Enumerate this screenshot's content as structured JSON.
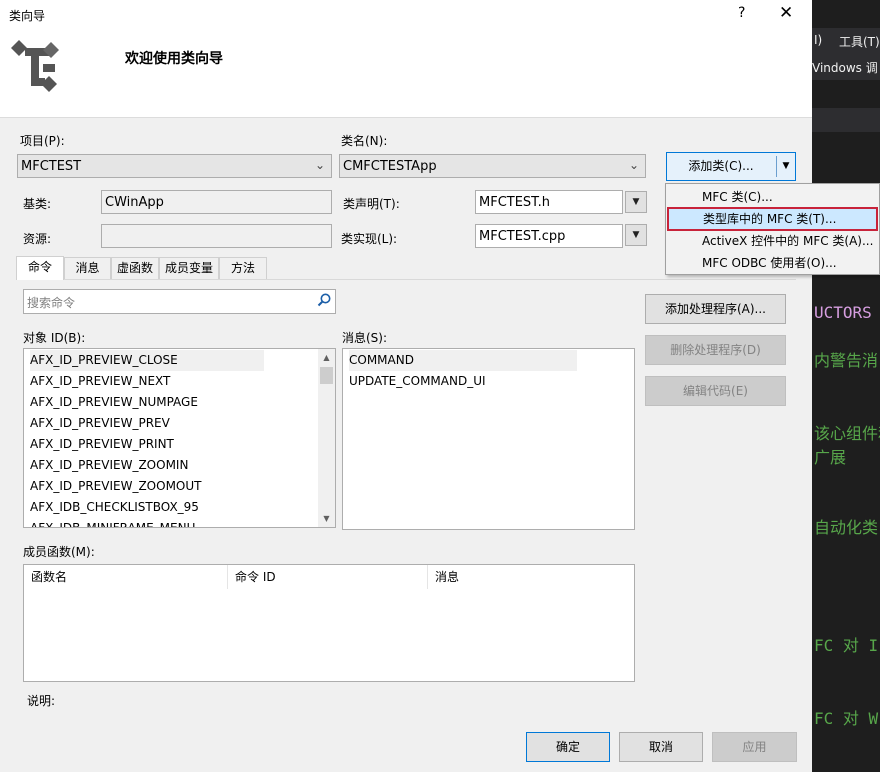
{
  "background_ide": {
    "menu_partial": "I)",
    "menu_tools": "工具(T)",
    "toolbar_partial": "Vindows 调",
    "code_lines": [
      {
        "text": "UCTORS",
        "color": "#d69ee0"
      },
      {
        "text": "内警告消",
        "color": "#57a64a"
      },
      {
        "text": "该心组件和",
        "color": "#57a64a"
      },
      {
        "text": "广展",
        "color": "#57a64a"
      },
      {
        "text": "自动化类",
        "color": "#57a64a"
      },
      {
        "text": "FC 对 I",
        "color": "#57a64a"
      },
      {
        "text": "FC 对 W",
        "color": "#57a64a"
      }
    ]
  },
  "dialog": {
    "title": "类向导",
    "help_glyph": "?",
    "close_glyph": "✕",
    "welcome": "欢迎使用类向导"
  },
  "project": {
    "label": "项目(P):",
    "value": "MFCTEST"
  },
  "classname": {
    "label": "类名(N):",
    "value": "CMFCTESTApp"
  },
  "add_class": {
    "label": "添加类(C)...",
    "menu": [
      "MFC 类(C)...",
      "类型库中的 MFC 类(T)...",
      "ActiveX 控件中的 MFC 类(A)...",
      "MFC ODBC 使用者(O)..."
    ],
    "highlighted_index": 1
  },
  "base_class": {
    "label": "基类:",
    "value": "CWinApp"
  },
  "resource": {
    "label": "资源:",
    "value": ""
  },
  "class_decl": {
    "label": "类声明(T):",
    "value": "MFCTEST.h"
  },
  "class_impl": {
    "label": "类实现(L):",
    "value": "MFCTEST.cpp"
  },
  "tabs": [
    "命令",
    "消息",
    "虚函数",
    "成员变量",
    "方法"
  ],
  "active_tab": 0,
  "search": {
    "placeholder": "搜索命令"
  },
  "object_ids": {
    "label": "对象 ID(B):",
    "items": [
      "AFX_ID_PREVIEW_CLOSE",
      "AFX_ID_PREVIEW_NEXT",
      "AFX_ID_PREVIEW_NUMPAGE",
      "AFX_ID_PREVIEW_PREV",
      "AFX_ID_PREVIEW_PRINT",
      "AFX_ID_PREVIEW_ZOOMIN",
      "AFX_ID_PREVIEW_ZOOMOUT",
      "AFX_IDB_CHECKLISTBOX_95",
      "AFX_IDB_MINIFRAME_MENU"
    ],
    "selected_index": 0
  },
  "messages": {
    "label": "消息(S):",
    "items": [
      "COMMAND",
      "UPDATE_COMMAND_UI"
    ],
    "selected_index": 0
  },
  "handler_buttons": {
    "add": "添加处理程序(A)...",
    "delete": "删除处理程序(D)",
    "edit": "编辑代码(E)"
  },
  "member_functions": {
    "label": "成员函数(M):",
    "columns": [
      "函数名",
      "命令 ID",
      "消息"
    ]
  },
  "description": {
    "label": "说明:"
  },
  "footer": {
    "ok": "确定",
    "cancel": "取消",
    "apply": "应用"
  }
}
